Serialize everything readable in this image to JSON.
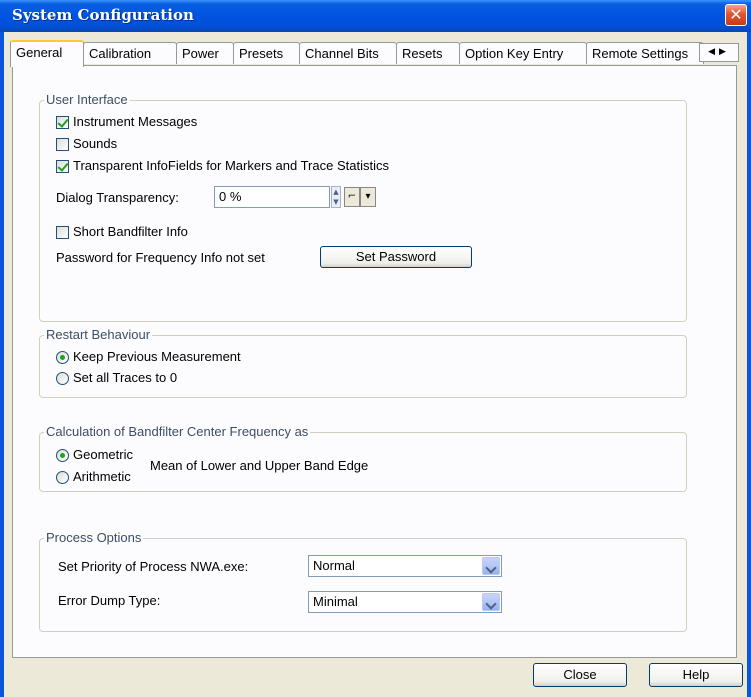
{
  "window": {
    "title": "System Configuration"
  },
  "tabs": [
    {
      "label": "General"
    },
    {
      "label": "Calibration"
    },
    {
      "label": "Power"
    },
    {
      "label": "Presets"
    },
    {
      "label": "Channel Bits"
    },
    {
      "label": "Resets"
    },
    {
      "label": "Option Key Entry"
    },
    {
      "label": "Remote Settings"
    }
  ],
  "user_interface": {
    "title": "User Interface",
    "instrument_messages": {
      "label": "Instrument Messages",
      "checked": true
    },
    "sounds": {
      "label": "Sounds",
      "checked": false
    },
    "transparent_infofields": {
      "label": "Transparent InfoFields for Markers and Trace Statistics",
      "checked": true
    },
    "dialog_transparency_label": "Dialog Transparency:",
    "dialog_transparency_value": "0 %",
    "short_bandfilter": {
      "label": "Short Bandfilter Info",
      "checked": false
    },
    "password_status": "Password for Frequency Info not set",
    "set_password_label": "Set Password"
  },
  "restart_behaviour": {
    "title": "Restart Behaviour",
    "options": [
      {
        "label": "Keep Previous Measurement",
        "selected": true
      },
      {
        "label": "Set all Traces to 0",
        "selected": false
      }
    ]
  },
  "bandfilter_calc": {
    "title": "Calculation of Bandfilter Center Frequency as",
    "options": [
      {
        "label": "Geometric",
        "selected": true
      },
      {
        "label": "Arithmetic",
        "selected": false
      }
    ],
    "suffix": "Mean of Lower and Upper Band Edge"
  },
  "process_options": {
    "title": "Process Options",
    "priority_label": "Set Priority of Process NWA.exe:",
    "priority_value": "Normal",
    "dump_label": "Error Dump Type:",
    "dump_value": "Minimal"
  },
  "footer": {
    "close_label": "Close",
    "help_label": "Help"
  }
}
